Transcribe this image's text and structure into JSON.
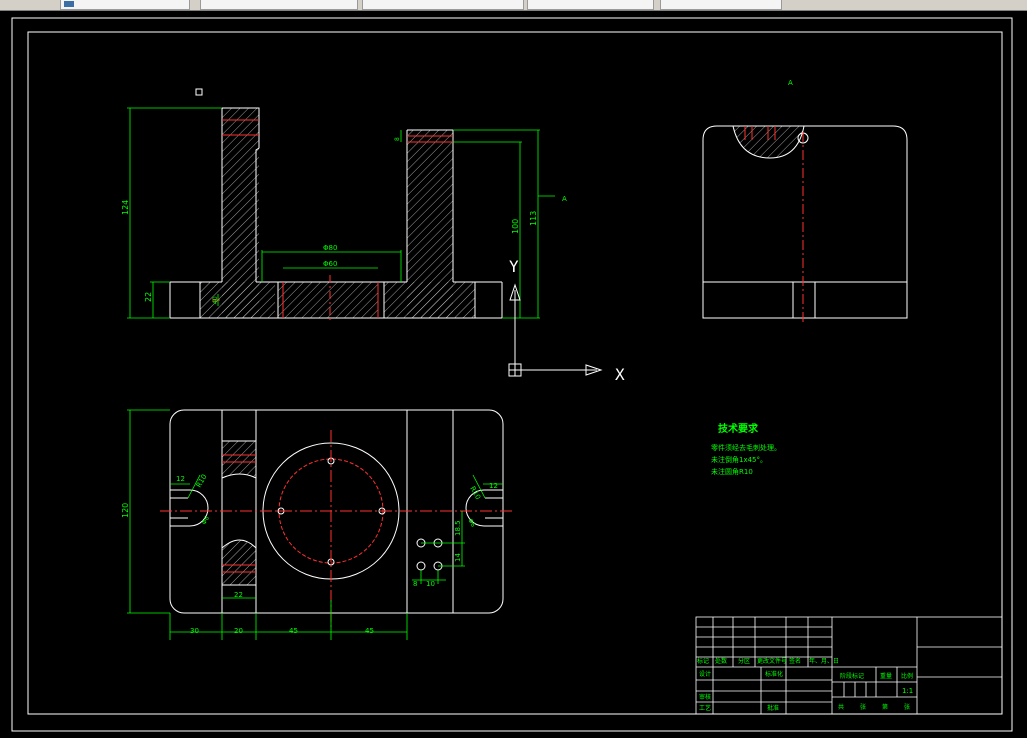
{
  "tabs": [
    {
      "label": ""
    },
    {
      "label": ""
    },
    {
      "label": ""
    },
    {
      "label": ""
    },
    {
      "label": ""
    }
  ],
  "dims": {
    "d124": "124",
    "d22": "22",
    "d40": "40",
    "d80": "Φ80",
    "d60": "Φ60",
    "d8": "8",
    "d100": "100",
    "d113": "113",
    "dA": "A",
    "dA2": "A",
    "d120": "120",
    "d12a": "12",
    "d12b": "12",
    "r10a": "R10",
    "r10b": "R10",
    "d6a": "Φ6",
    "d6b": "Φ6",
    "d22b": "22",
    "d185": "18.5",
    "d14": "14",
    "d8b": "8",
    "d10": "10",
    "d30": "30",
    "d20": "20",
    "d45a": "45",
    "d45b": "45"
  },
  "ucs": {
    "y": "Y",
    "x": "X"
  },
  "notes": {
    "title": "技术要求",
    "line1": "零件须经去毛刺处理。",
    "line2": "未注倒角1x45°。",
    "line3": "未注圆角R10"
  },
  "titleblock": {
    "c_mark": "标记",
    "c_count": "处数",
    "c_zone": "分区",
    "c_doc": "更改文件号",
    "c_sign": "签名",
    "c_date": "年、月、日",
    "c_design": "设计",
    "c_std": "标准化",
    "c_stage": "阶段标记",
    "c_weight": "重量",
    "c_scale": "比例",
    "scale": "1:1",
    "c_review": "审核",
    "c_craft": "工艺",
    "c_approve": "批准",
    "c_total": "共",
    "c_zhang1": "张",
    "c_di": "第",
    "c_zhang2": "张"
  }
}
